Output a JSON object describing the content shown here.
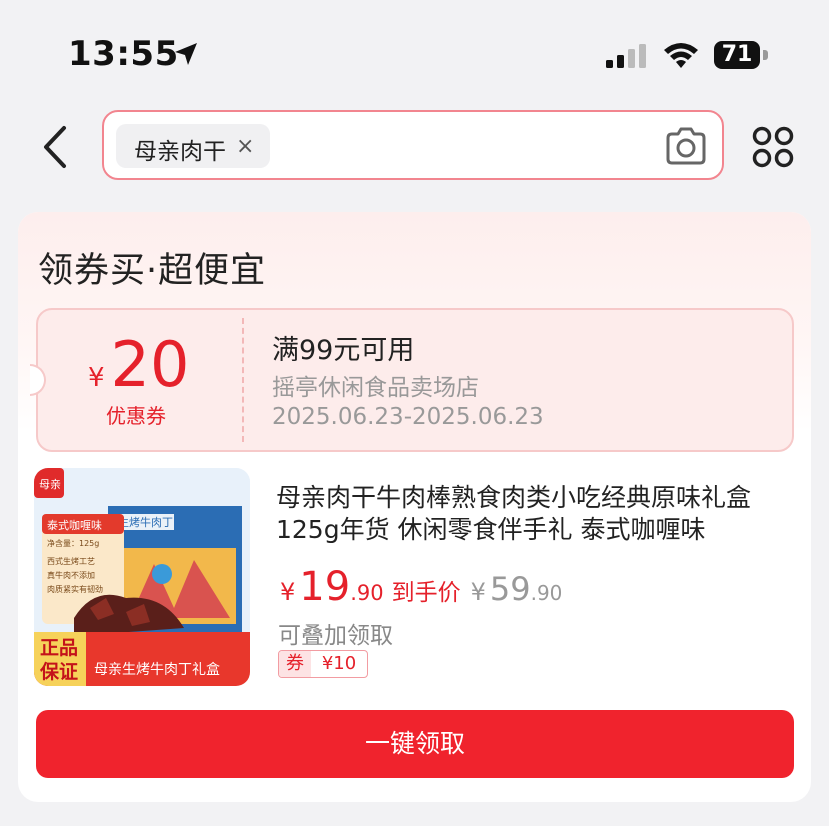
{
  "status_bar": {
    "time": "13:55",
    "battery": "71"
  },
  "search": {
    "tag": "母亲肉干",
    "tag_close": "×"
  },
  "card": {
    "title": "领券买·超便宜",
    "coupon": {
      "currency": "¥",
      "amount": "20",
      "label": "优惠券",
      "condition": "满99元可用",
      "shop": "摇亭休闲食品卖场店",
      "date_range": "2025.06.23-2025.06.23"
    },
    "product": {
      "title": "母亲肉干牛肉棒熟食肉类小吃经典原味礼盒125g年货 休闲零食伴手礼 泰式咖喱味",
      "image_texts": {
        "brand": "母亲",
        "flavor": "泰式咖喱味",
        "net_weight": "净含量：125g",
        "features": [
          "西式生烤工艺",
          "真牛肉不添加",
          "肉质紧实有韧劲"
        ],
        "box_label": "生烤牛肉丁",
        "guarantee_line1": "正品",
        "guarantee_line2": "保证",
        "banner": "母亲生烤牛肉丁礼盒"
      },
      "price_currency": "¥",
      "price_int": "19",
      "price_dec": ".90",
      "price_tag": "到手价",
      "orig_currency": "¥",
      "orig_int": "59",
      "orig_dec": ".90",
      "stack_label": "可叠加领取",
      "voucher_label": "券",
      "voucher_amount": "¥10"
    },
    "claim_button": "一键领取"
  },
  "colors": {
    "accent": "#f0232d",
    "price": "#e5212b",
    "coupon_bg": "#fdeceb"
  }
}
